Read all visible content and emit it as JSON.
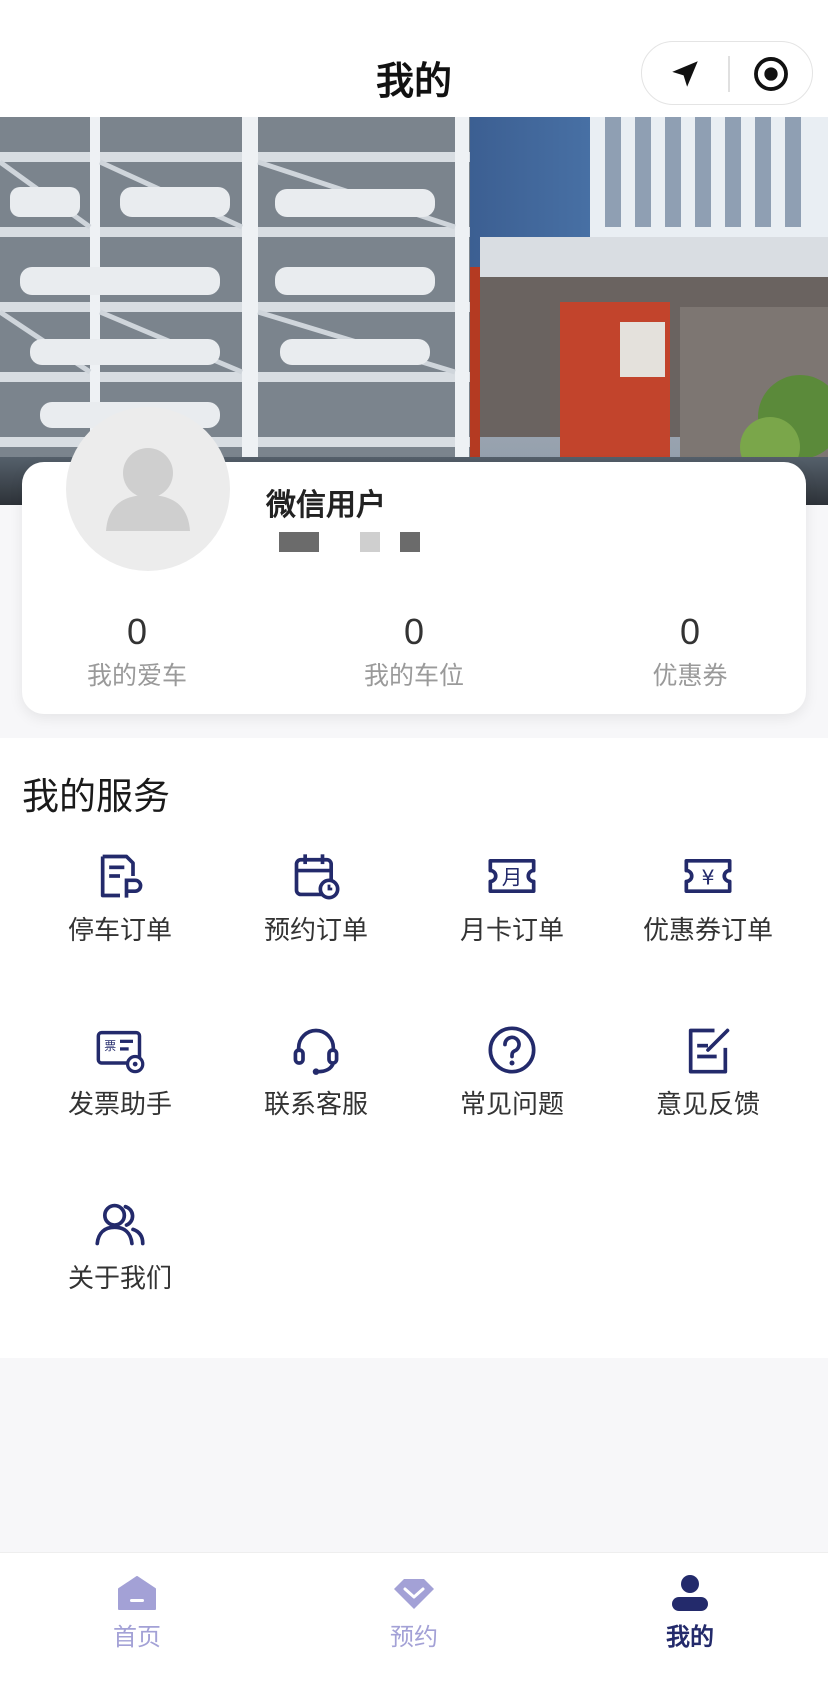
{
  "navbar": {
    "title": "我的",
    "capsule_left_icon": "location-arrow-icon",
    "capsule_right_icon": "target-circle-icon"
  },
  "banner": {
    "image": "parking-garage-photo"
  },
  "profile": {
    "username": "微信用户",
    "avatar_icon": "person-silhouette-icon",
    "stats": [
      {
        "value": "0",
        "label": "我的爱车"
      },
      {
        "value": "0",
        "label": "我的车位"
      },
      {
        "value": "0",
        "label": "优惠券"
      }
    ]
  },
  "services": {
    "title": "我的服务",
    "items": [
      {
        "label": "停车订单",
        "icon": "parking-order-icon"
      },
      {
        "label": "预约订单",
        "icon": "calendar-clock-icon"
      },
      {
        "label": "月卡订单",
        "icon": "month-ticket-icon"
      },
      {
        "label": "优惠券订单",
        "icon": "yen-coupon-icon"
      },
      {
        "label": "发票助手",
        "icon": "invoice-gear-icon",
        "icon_text": "票"
      },
      {
        "label": "联系客服",
        "icon": "headset-icon"
      },
      {
        "label": "常见问题",
        "icon": "question-circle-icon"
      },
      {
        "label": "意见反馈",
        "icon": "edit-note-icon"
      },
      {
        "label": "关于我们",
        "icon": "users-icon"
      }
    ]
  },
  "tabbar": {
    "items": [
      {
        "label": "首页",
        "icon": "home-icon",
        "active": false
      },
      {
        "label": "预约",
        "icon": "diamond-icon",
        "active": false
      },
      {
        "label": "我的",
        "icon": "user-icon",
        "active": true
      }
    ]
  },
  "colors": {
    "accent": "#232a6b",
    "tab_inactive": "#a3a1d6",
    "muted_text": "#9a9a9a"
  }
}
